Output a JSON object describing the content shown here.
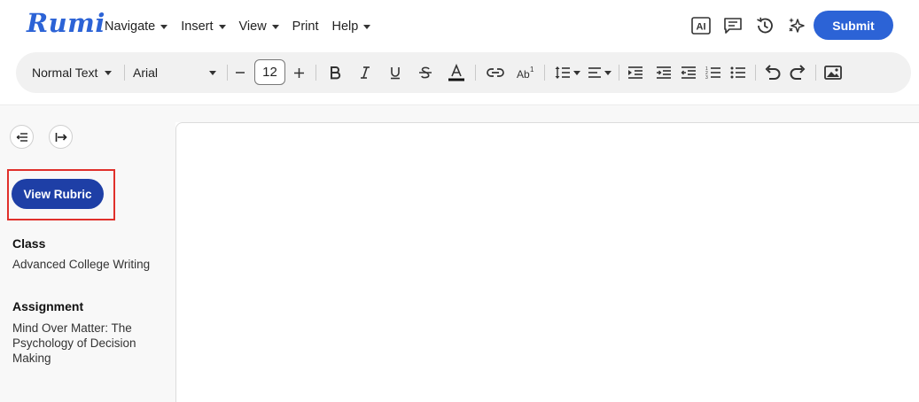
{
  "app": {
    "logo": "Rumi"
  },
  "menu": [
    {
      "label": "Navigate",
      "dropdown": true
    },
    {
      "label": "Insert",
      "dropdown": true
    },
    {
      "label": "View",
      "dropdown": true
    },
    {
      "label": "Print",
      "dropdown": false
    },
    {
      "label": "Help",
      "dropdown": true
    }
  ],
  "top_icons": [
    "ai-icon",
    "comment-icon",
    "history-icon",
    "sparkle-icon"
  ],
  "submit": {
    "label": "Submit"
  },
  "toolbar": {
    "text_style": "Normal Text",
    "font_family": "Arial",
    "font_size": "12",
    "icons": [
      "decrease-font-icon",
      "increase-font-icon",
      "bold-icon",
      "italic-icon",
      "underline-icon",
      "strikethrough-icon",
      "text-color-icon",
      "link-icon",
      "superscript-icon",
      "line-spacing-icon",
      "align-icon",
      "indent-icon",
      "indent-alt-icon",
      "outdent-icon",
      "numbered-list-icon",
      "bullet-list-icon",
      "undo-icon",
      "redo-icon",
      "image-icon"
    ]
  },
  "sidebar": {
    "view_rubric": "View Rubric",
    "class_heading": "Class",
    "class_value": "Advanced College Writing",
    "assignment_heading": "Assignment",
    "assignment_value": "Mind Over Matter: The Psychology of Decision Making"
  },
  "colors": {
    "brand": "#2c63d6",
    "rubric_button": "#1e3fa6",
    "highlight": "#e0302b"
  }
}
